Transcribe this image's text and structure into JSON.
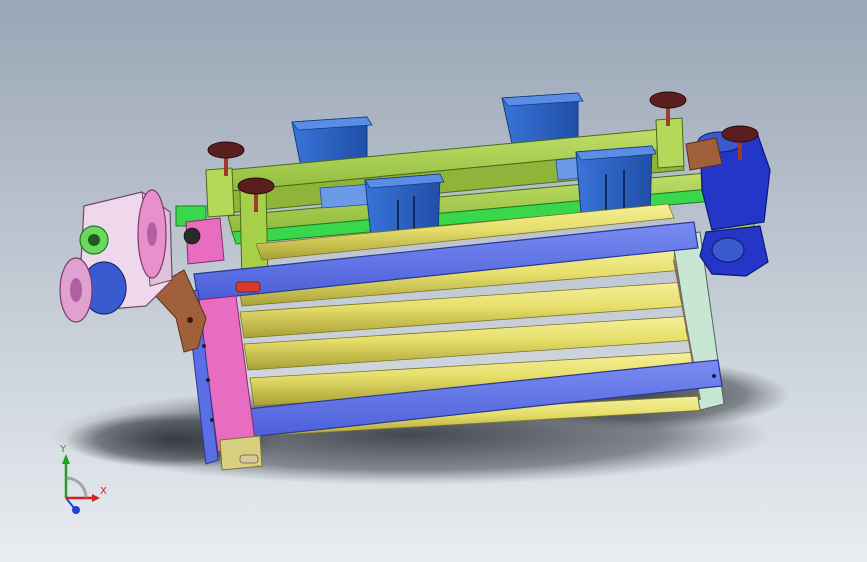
{
  "viewport": {
    "background_top": "#9aa6b6",
    "background_bottom": "#e8ecf0",
    "shadow_color": "#2a2e36"
  },
  "model_colors": {
    "roller": "#e6df6a",
    "roller_shade": "#b5ae3e",
    "blue_bar": "#5a6fe6",
    "blue_bar_edge": "#2a3890",
    "pink_plate": "#e86dc0",
    "green_frame": "#a6cf4a",
    "green_bright": "#39d84a",
    "mounting_bracket": "#2d63c8",
    "knob": "#5a1e1e",
    "knob_stem": "#a03a2e",
    "gearbox": "#f0d8ec",
    "motor_blue": "#3a5ad0",
    "motor_right": "#2436c8",
    "bronze": "#a0603a",
    "side_plate_right": "#c8e6d4"
  },
  "triad": {
    "x_label": "X",
    "y_label": "Y",
    "x_color": "#d42020",
    "y_color": "#20a020",
    "z_color": "#2040d0"
  }
}
